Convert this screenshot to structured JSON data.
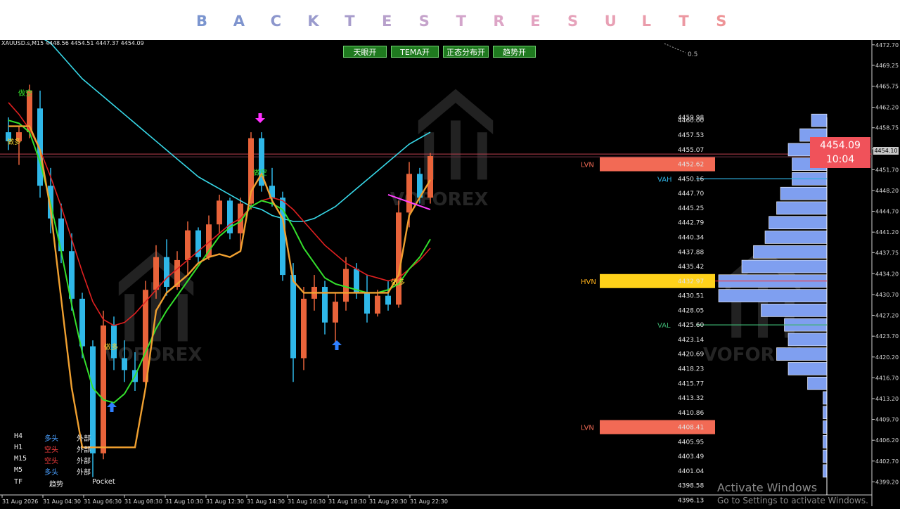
{
  "banner": {
    "letters": [
      "B",
      "A",
      "C",
      "K",
      "T",
      "E",
      "S",
      "T",
      "R",
      "E",
      "S",
      "U",
      "L",
      "T",
      "S"
    ],
    "colors": [
      "#7b95cf",
      "#7f94ce",
      "#8d97cd",
      "#9a9bcd",
      "#a89dcc",
      "#b7a0cb",
      "#c5a3cb",
      "#d3a5cb",
      "#dda5c6",
      "#e3a4c1",
      "#e6a3bb",
      "#e8a0b4",
      "#ea9cab",
      "#ec98a2",
      "#ee9497"
    ]
  },
  "symbol_info": "XAUUSD.s,M15  4448.56 4454.51 4447.37 4454.09",
  "buttons": [
    {
      "label": "天眼开"
    },
    {
      "label": "TEMA开"
    },
    {
      "label": "正态分布开"
    },
    {
      "label": "趋势开"
    }
  ],
  "axis": {
    "price_ticks": [
      "4472.70",
      "4469.25",
      "4465.75",
      "4462.20",
      "4458.75",
      "4455.20",
      "4451.70",
      "4448.20",
      "4444.70",
      "4441.20",
      "4437.75",
      "4434.20",
      "4430.70",
      "4427.20",
      "4423.70",
      "4420.20",
      "4416.70",
      "4413.20",
      "4409.70",
      "4406.20",
      "4402.70",
      "4399.20"
    ],
    "time_ticks": [
      "31 Aug 2026",
      "31 Aug 04:30",
      "31 Aug 06:30",
      "31 Aug 08:30",
      "31 Aug 10:30",
      "31 Aug 12:30",
      "31 Aug 14:30",
      "31 Aug 16:30",
      "31 Aug 18:30",
      "31 Aug 20:30",
      "31 Aug 22:30"
    ],
    "current_price_tag": "4454.10"
  },
  "fib_label": "0.5",
  "price_label": {
    "price": "4454.09",
    "countdown": "10:04"
  },
  "volume_profile": {
    "levels": [
      "4460.00",
      "4457.53",
      "4455.07",
      "4452.62",
      "4450.16",
      "4447.70",
      "4445.25",
      "4442.79",
      "4440.34",
      "4437.88",
      "4435.42",
      "4432.97",
      "4430.51",
      "4428.05",
      "4425.60",
      "4423.14",
      "4420.69",
      "4418.23",
      "4415.77",
      "4413.32",
      "4410.86",
      "4408.41",
      "4405.95",
      "4403.49",
      "4401.04",
      "4398.58",
      "4396.13"
    ],
    "top_labels": [
      "4460.00",
      "4459.98"
    ],
    "zones": [
      {
        "name": "LVN",
        "price": "4452.62",
        "color": "#f26a55",
        "label_color": "#f26a55"
      },
      {
        "name": "HVN",
        "price": "4432.97",
        "color": "#ffd21a",
        "label_color": "#ffb21a"
      },
      {
        "name": "LVN",
        "price": "4408.41",
        "color": "#f26a55",
        "label_color": "#f26a55"
      }
    ],
    "vah": {
      "name": "VAH",
      "price": "4450.16",
      "color": "#30b0e0"
    },
    "val": {
      "name": "VAL",
      "price": "4425.60",
      "color": "#3cb371"
    },
    "volumes": [
      4,
      7,
      10,
      9,
      9,
      12,
      13,
      15,
      16,
      19,
      22,
      28,
      28,
      17,
      11,
      10,
      13,
      10,
      5,
      1,
      1,
      1,
      1,
      1,
      1,
      0,
      0
    ],
    "bar_color": "#7f9ff0"
  },
  "chart_data": {
    "type": "candlestick",
    "ylim": [
      4397.0,
      4473.5
    ],
    "candles": [
      {
        "o": 4458.0,
        "h": 4460.5,
        "l": 4455.0,
        "c": 4456.5
      },
      {
        "o": 4456.5,
        "h": 4459.0,
        "l": 4452.5,
        "c": 4458.0
      },
      {
        "o": 4458.0,
        "h": 4466.0,
        "l": 4457.0,
        "c": 4465.0
      },
      {
        "o": 4462.0,
        "h": 4465.0,
        "l": 4447.0,
        "c": 4449.0
      },
      {
        "o": 4449.0,
        "h": 4452.0,
        "l": 4441.0,
        "c": 4443.5
      },
      {
        "o": 4443.5,
        "h": 4446.0,
        "l": 4436.0,
        "c": 4438.0
      },
      {
        "o": 4438.0,
        "h": 4441.0,
        "l": 4428.0,
        "c": 4430.0
      },
      {
        "o": 4430.0,
        "h": 4431.0,
        "l": 4420.0,
        "c": 4422.0
      },
      {
        "o": 4422.0,
        "h": 4423.0,
        "l": 4400.0,
        "c": 4404.0
      },
      {
        "o": 4404.0,
        "h": 4428.0,
        "l": 4403.0,
        "c": 4425.5
      },
      {
        "o": 4425.5,
        "h": 4427.0,
        "l": 4418.0,
        "c": 4420.0
      },
      {
        "o": 4420.0,
        "h": 4423.0,
        "l": 4416.0,
        "c": 4418.0
      },
      {
        "o": 4418.0,
        "h": 4421.0,
        "l": 4414.5,
        "c": 4416.0
      },
      {
        "o": 4416.0,
        "h": 4433.0,
        "l": 4415.0,
        "c": 4431.5
      },
      {
        "o": 4431.5,
        "h": 4439.0,
        "l": 4430.0,
        "c": 4437.0
      },
      {
        "o": 4437.0,
        "h": 4440.0,
        "l": 4430.5,
        "c": 4432.0
      },
      {
        "o": 4432.0,
        "h": 4438.0,
        "l": 4431.5,
        "c": 4436.5
      },
      {
        "o": 4436.5,
        "h": 4443.0,
        "l": 4434.0,
        "c": 4441.5
      },
      {
        "o": 4441.5,
        "h": 4442.0,
        "l": 4436.0,
        "c": 4437.0
      },
      {
        "o": 4437.0,
        "h": 4444.0,
        "l": 4436.5,
        "c": 4442.5
      },
      {
        "o": 4442.5,
        "h": 4447.5,
        "l": 4441.0,
        "c": 4446.5
      },
      {
        "o": 4446.5,
        "h": 4447.0,
        "l": 4440.0,
        "c": 4441.0
      },
      {
        "o": 4441.0,
        "h": 4447.0,
        "l": 4438.0,
        "c": 4446.0
      },
      {
        "o": 4446.0,
        "h": 4458.0,
        "l": 4445.0,
        "c": 4457.0
      },
      {
        "o": 4457.0,
        "h": 4458.0,
        "l": 4448.0,
        "c": 4449.0
      },
      {
        "o": 4449.0,
        "h": 4452.0,
        "l": 4445.5,
        "c": 4447.0
      },
      {
        "o": 4447.0,
        "h": 4448.0,
        "l": 4433.0,
        "c": 4434.0
      },
      {
        "o": 4434.0,
        "h": 4436.0,
        "l": 4416.0,
        "c": 4420.0
      },
      {
        "o": 4420.0,
        "h": 4432.0,
        "l": 4418.0,
        "c": 4430.0
      },
      {
        "o": 4430.0,
        "h": 4434.0,
        "l": 4428.0,
        "c": 4432.0
      },
      {
        "o": 4432.0,
        "h": 4433.0,
        "l": 4424.0,
        "c": 4426.0
      },
      {
        "o": 4426.0,
        "h": 4431.0,
        "l": 4422.5,
        "c": 4429.5
      },
      {
        "o": 4429.5,
        "h": 4437.0,
        "l": 4428.0,
        "c": 4435.0
      },
      {
        "o": 4435.0,
        "h": 4436.0,
        "l": 4430.0,
        "c": 4431.0
      },
      {
        "o": 4431.0,
        "h": 4434.0,
        "l": 4426.0,
        "c": 4427.5
      },
      {
        "o": 4427.5,
        "h": 4431.5,
        "l": 4427.0,
        "c": 4430.5
      },
      {
        "o": 4430.5,
        "h": 4433.0,
        "l": 4428.0,
        "c": 4429.0
      },
      {
        "o": 4429.0,
        "h": 4446.5,
        "l": 4428.5,
        "c": 4444.5
      },
      {
        "o": 4444.5,
        "h": 4453.0,
        "l": 4442.0,
        "c": 4451.0
      },
      {
        "o": 4451.0,
        "h": 4452.0,
        "l": 4446.0,
        "c": 4447.0
      },
      {
        "o": 4447.0,
        "h": 4454.5,
        "l": 4446.0,
        "c": 4454.0
      }
    ],
    "tema_orange": [
      4459.0,
      4459.0,
      4459.0,
      4455.0,
      4445.0,
      4430.0,
      4415.0,
      4405.0,
      4405.0,
      4405.0,
      4405.0,
      4405.0,
      4405.0,
      4415.0,
      4428.0,
      4431.0,
      4432.5,
      4434.0,
      4436.0,
      4437.0,
      4437.5,
      4437.0,
      4438.0,
      4448.0,
      4451.0,
      4446.5,
      4443.5,
      4433.0,
      4431.0,
      4431.0,
      4431.0,
      4431.0,
      4431.0,
      4431.0,
      4431.0,
      4431.0,
      4431.0,
      4434.0,
      4444.0,
      4447.0,
      4450.0
    ],
    "green_ma": [
      4460.0,
      4459.5,
      4458.0,
      4453.0,
      4446.0,
      4438.0,
      4429.0,
      4421.0,
      4415.0,
      4413.0,
      4412.5,
      4414.0,
      4417.0,
      4421.0,
      4425.0,
      4428.0,
      4430.5,
      4433.0,
      4435.5,
      4438.0,
      4440.5,
      4442.0,
      4443.0,
      4445.5,
      4446.5,
      4446.0,
      4445.0,
      4442.0,
      4438.5,
      4436.0,
      4433.5,
      4432.5,
      4432.0,
      4431.5,
      4431.0,
      4431.0,
      4431.5,
      4432.5,
      4435.0,
      4437.0,
      4440.0
    ],
    "red_ma": [
      4463.0,
      4461.0,
      4458.5,
      4455.0,
      4450.5,
      4445.5,
      4440.0,
      4434.5,
      4429.5,
      4426.5,
      4425.5,
      4426.0,
      4427.5,
      4429.5,
      4431.5,
      4433.5,
      4435.0,
      4436.5,
      4438.0,
      4439.5,
      4441.0,
      4442.5,
      4443.5,
      4445.5,
      4446.5,
      4447.0,
      4446.5,
      4445.0,
      4443.0,
      4441.0,
      4439.0,
      4437.5,
      4436.0,
      4435.0,
      4434.0,
      4433.5,
      4433.0,
      4433.5,
      4435.0,
      4436.5,
      4438.5
    ],
    "cyan_ma": [
      4476.0,
      4475.5,
      4475.0,
      4474.0,
      4473.0,
      4471.0,
      4469.0,
      4467.0,
      4465.5,
      4464.0,
      4462.5,
      4461.0,
      4459.5,
      4458.0,
      4456.5,
      4455.0,
      4453.5,
      4452.0,
      4450.5,
      4449.5,
      4448.5,
      4447.5,
      4446.5,
      4445.5,
      4445.0,
      4444.0,
      4443.5,
      4443.0,
      4443.0,
      4443.5,
      4444.5,
      4445.5,
      4447.0,
      4448.5,
      4450.0,
      4451.5,
      4453.0,
      4454.5,
      4456.0,
      4457.0,
      4458.0
    ]
  },
  "signals": {
    "sell_top": "做空",
    "buy_left": "做多",
    "sell_mid": "做空",
    "buy_low": "做多",
    "buy_right": "做多"
  },
  "trend_table": {
    "rows": [
      {
        "tf": "H4",
        "trend": "多头",
        "trend_color": "#4aa0ff",
        "pos": "外部"
      },
      {
        "tf": "H1",
        "trend": "空头",
        "trend_color": "#ff4040",
        "pos": "外部"
      },
      {
        "tf": "M15",
        "trend": "空头",
        "trend_color": "#ff4040",
        "pos": "外部"
      },
      {
        "tf": "M5",
        "trend": "多头",
        "trend_color": "#4aa0ff",
        "pos": "外部"
      }
    ],
    "header": {
      "tf": "TF",
      "trend": "趋势",
      "pos": "Pocket"
    }
  },
  "watermark": "VOFOREX",
  "activate": {
    "title": "Activate Windows",
    "sub": "Go to Settings to activate Windows."
  }
}
